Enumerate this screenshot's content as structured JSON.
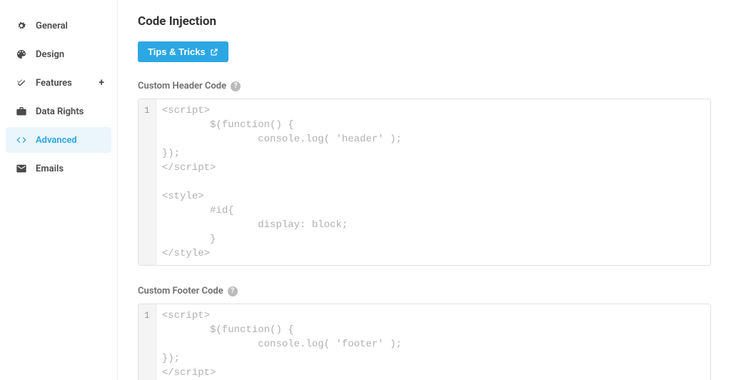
{
  "sidebar": {
    "items": [
      {
        "label": "General",
        "icon": "settings-icon"
      },
      {
        "label": "Design",
        "icon": "palette-icon"
      },
      {
        "label": "Features",
        "icon": "check-icon",
        "expandable": true
      },
      {
        "label": "Data Rights",
        "icon": "briefcase-icon"
      },
      {
        "label": "Advanced",
        "icon": "code-icon",
        "active": true
      },
      {
        "label": "Emails",
        "icon": "envelope-icon"
      }
    ]
  },
  "main": {
    "title": "Code Injection",
    "tips_button_label": "Tips & Tricks",
    "sections": {
      "header": {
        "label": "Custom Header Code",
        "code": "<script>\n        $(function() {\n                console.log( 'header' );\n});\n</script>\n\n<style>\n        #id{\n                display: block;\n        }\n</style>",
        "line_start": "1"
      },
      "footer": {
        "label": "Custom Footer Code",
        "code": "<script>\n        $(function() {\n                console.log( 'footer' );\n});\n</script>",
        "line_start": "1"
      }
    }
  }
}
